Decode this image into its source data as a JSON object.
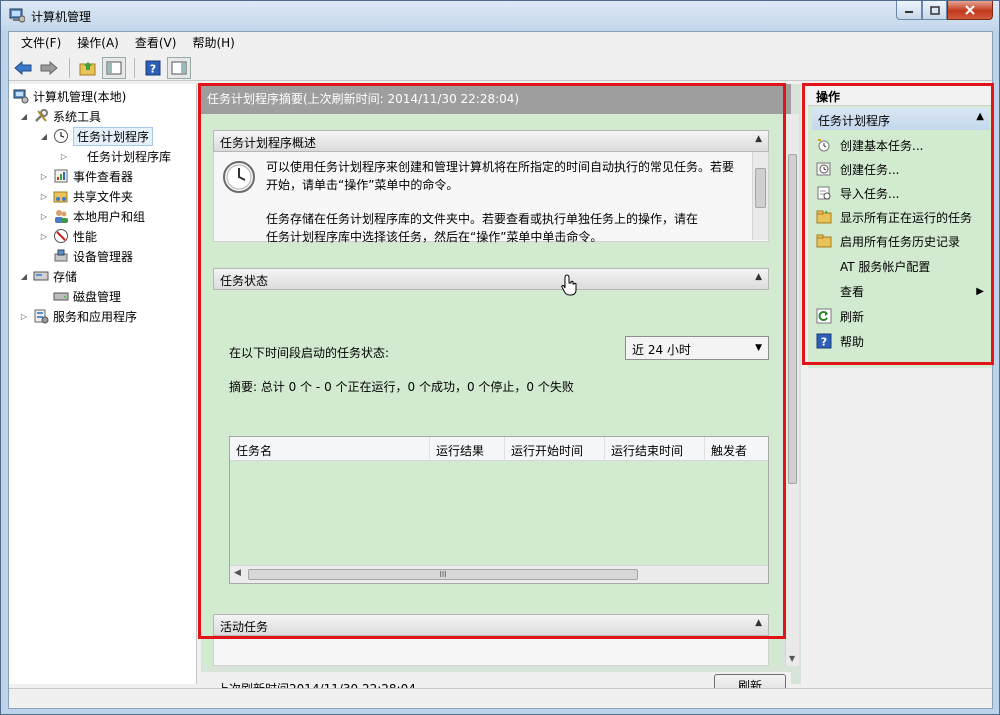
{
  "window": {
    "title": "计算机管理"
  },
  "menu": [
    {
      "label": "文件(F)"
    },
    {
      "label": "操作(A)"
    },
    {
      "label": "查看(V)"
    },
    {
      "label": "帮助(H)"
    }
  ],
  "tree": {
    "root": "计算机管理(本地)",
    "system_tools": "系统工具",
    "task_scheduler": "任务计划程序",
    "task_library": "任务计划程序库",
    "event_viewer": "事件查看器",
    "shared_folders": "共享文件夹",
    "local_users": "本地用户和组",
    "performance": "性能",
    "device_manager": "设备管理器",
    "storage": "存储",
    "disk_management": "磁盘管理",
    "services_apps": "服务和应用程序"
  },
  "middle": {
    "header": "任务计划程序摘要(上次刷新时间: 2014/11/30 22:28:04)",
    "overview": {
      "title": "任务计划程序概述",
      "para1_line1": "可以使用任务计划程序来创建和管理计算机将在所指定的时间自动执行的常见任务。若要",
      "para1_line2": "开始，请单击“操作”菜单中的命令。",
      "para2_line1": "任务存储在任务计划程序库的文件夹中。若要查看或执行单独任务上的操作，请在",
      "para2_line2": "任务计划程序库中选择该任务，然后在“操作”菜单中单击命令。"
    },
    "status": {
      "title": "任务状态",
      "period_label": "在以下时间段启动的任务状态:",
      "period_value": "近 24 小时",
      "summary": "摘要: 总计 0 个 - 0 个正在运行，0 个成功，0 个停止，0 个失败",
      "columns": [
        "任务名",
        "运行结果",
        "运行开始时间",
        "运行结束时间",
        "触发者"
      ],
      "hscroll_glyph": "III"
    },
    "active": {
      "title": "活动任务"
    },
    "last_refresh": "上次刷新时间2014/11/30 22:28:04",
    "refresh_button": "刷新"
  },
  "actions": {
    "title": "操作",
    "section": "任务计划程序",
    "items": [
      {
        "label": "创建基本任务..."
      },
      {
        "label": "创建任务..."
      },
      {
        "label": "导入任务..."
      },
      {
        "label": "显示所有正在运行的任务"
      },
      {
        "label": "启用所有任务历史记录"
      },
      {
        "label": "AT 服务帐户配置"
      },
      {
        "label": "查看"
      },
      {
        "label": "刷新"
      },
      {
        "label": "帮助"
      }
    ]
  },
  "colors": {
    "highlight": "#e2141a",
    "green_fill": "#d2ebd0",
    "header_gray": "#9e9e9e"
  }
}
